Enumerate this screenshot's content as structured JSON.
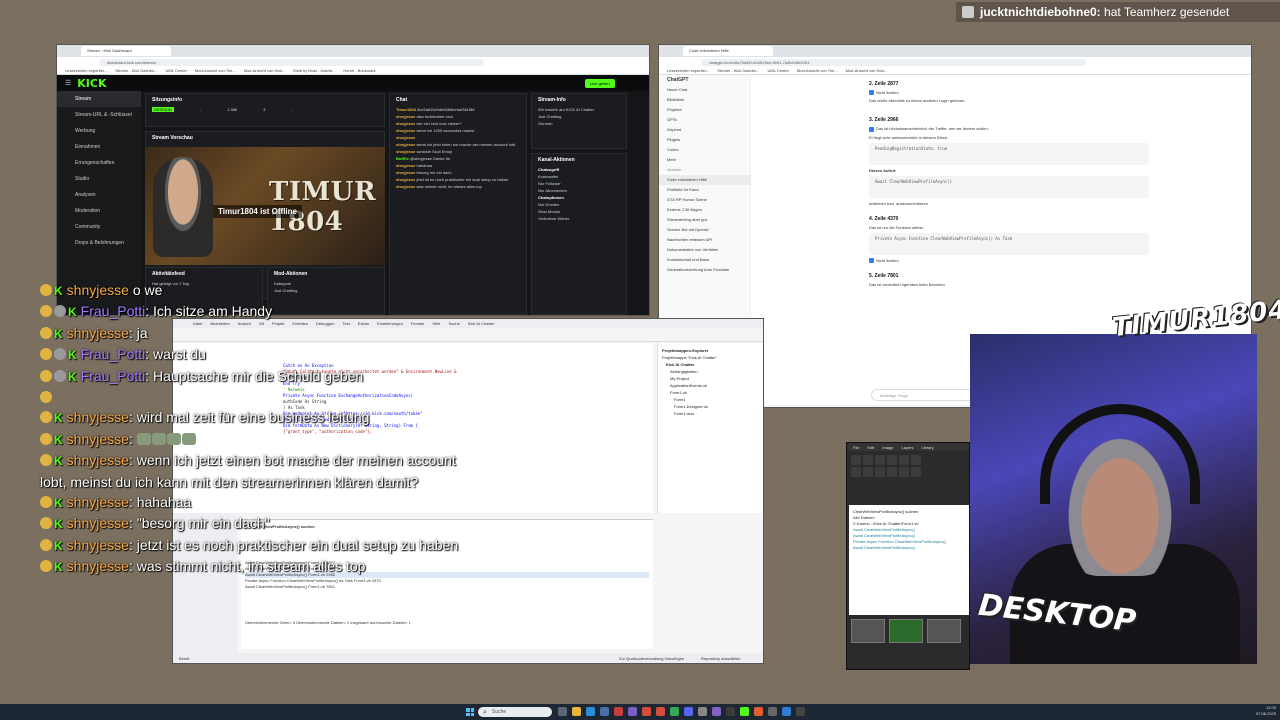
{
  "notification": {
    "user": "jucktnichtdiebohne0:",
    "text": " hat Teamherz gesendet"
  },
  "kick_window": {
    "tab_title": "Stream - Kick Dashboard",
    "url": "dashboard.kick.com/stream",
    "bookmarks": [
      "Lesezeichen importier...",
      "Stream - Kick Dashbo...",
      "UML Center",
      "Mod-Ansicht von Tim...",
      "Mod-Ansicht von Kick...",
      "Multi by Mobi - Dashb...",
      "Home - Bookmark"
    ],
    "logo": "KICK",
    "live_button": "Live gehen",
    "sidebar": [
      {
        "label": "Stream"
      },
      {
        "label": "Stream-URL & -Schlüssel"
      },
      {
        "label": "Werbung"
      },
      {
        "label": "Einnahmen"
      },
      {
        "label": "Errungenschaften"
      },
      {
        "label": "Studio"
      },
      {
        "label": "Analysen"
      },
      {
        "label": "Moderation"
      },
      {
        "label": "Community"
      },
      {
        "label": "Drops & Belohnungen"
      }
    ],
    "session_title": "Sitzungsinfo",
    "session_values": [
      "SESSION",
      "-",
      "1.386",
      "3",
      "-"
    ],
    "stream_preview_title": "Stream Vorschau",
    "banner_title": "TIMUR 1804",
    "offline_text": "Timur1804 ist Offline",
    "activity_title": "Aktivitätsfeed",
    "activity_row": "Hat gefolgt vor 1 Tag",
    "mod_title": "Mod-Aktionen",
    "mod_row_label": "Kategorie",
    "mod_row_value": "Just Chatting",
    "chat_title": "Chat",
    "chat_rows": [
      {
        "user": "Timur1804",
        "text": "5ce5a815c0db458dbefad381f86"
      },
      {
        "user": "shnyjesse",
        "text": "also funktioniert nice"
      },
      {
        "user": "shnyjesse",
        "text": "wie viel sind max viewer?"
      },
      {
        "user": "shnyjesse",
        "text": "wenn ich 1000 accountss mache"
      },
      {
        "user": "shnyjesse",
        "text": ""
      },
      {
        "user": "shnyjesse",
        "text": "wenn ich jetzt einen bot mache der meinen account lobt"
      },
      {
        "user": "shnyjesse",
        "text": "schickte Skull Emoji"
      },
      {
        "user": "BotRix",
        "text": "@shnyjesse Danke für"
      },
      {
        "user": "shnyjesse",
        "text": "hahahaa"
      },
      {
        "user": "shnyjesse",
        "text": "besorg mir ein dach"
      },
      {
        "user": "shnyjesse",
        "text": "jetzt ist es noch praktischer ein dual setup zu haben"
      },
      {
        "user": "shnyjesse",
        "text": "was stimmt nicht, im stream alles top"
      }
    ],
    "info_title": "Stream-Info",
    "info_text": "Wir basteln am KICK AI Chatter",
    "info_category": "Just Chatting",
    "info_language": "German",
    "channel_actions_title": "Kanal-Aktionen",
    "chat_access_title": "Chatzugriff",
    "chat_access_rows": [
      "Kontosalter",
      "Nur Follower",
      "Nur Abonnenten"
    ],
    "chat_options_title": "Chatoptionen",
    "chat_options_rows": [
      "Nur Emotes",
      "Slow-Modus",
      "Verbotene Wörter"
    ]
  },
  "gpt_window": {
    "tab_title": "Code extrahieren Hilfe",
    "url": "chatgpt.com/c/6a73d4f0-e0d5-f3ee-9b91-7a4be16b2291",
    "brand": "ChatGPT",
    "sidebar": [
      "Neuer Chat",
      "Bibliothek",
      "Projekte",
      "GPTs",
      "Gepinnt",
      "Plugins",
      "Codex",
      "Mehr",
      "Aktuelle",
      "Code extrahieren Hilfe",
      "Profilbild für Kand",
      "GTA RP Humor Szene",
      "Externe C30 Bogen",
      "Streamerbing aber gut",
      "Service Bot mit OpenAI",
      "Nachrichten erfassen API",
      "Dokumentation von Verfüllen",
      "Kontaktschalt und Bann",
      "Generationsrichtung Auto Produkte"
    ],
    "sections": [
      {
        "heading": "2. Zeile 2877",
        "text": "Nicht ändern",
        "note": "Das dürfte ebenfalls zu einem anderen Login gehören."
      },
      {
        "heading": "3. Zeile 2966",
        "text": "Das ist höchstwahrscheinlich der Treffer, den wir ändern wollen.",
        "note": "Er liegt sehr wahrscheinlich in diesem Block:"
      },
      {
        "heading": "",
        "text": "Diesen Aufruf:",
        "note": "entfernen bzw. auskommentieren."
      },
      {
        "heading": "4. Zeile 4370",
        "text": "Das ist nur die Funktion selbst:",
        "note": "Nicht ändern"
      },
      {
        "heading": "5. Zeile 7801",
        "text": "Das ist vermutlich irgendwo beim Beenden",
        "note": ""
      }
    ],
    "code_blocks": [
      "PendingRegistrationState: true",
      "Await ClearWebViewProfileAsync()",
      "Private Async Function ClearWebViewProfileAsync() As Task"
    ],
    "input_placeholder": "Beliebige Frage"
  },
  "vs_window": {
    "menu": [
      "Datei",
      "Bearbeiten",
      "Ansicht",
      "Git",
      "Projekt",
      "Erstellen",
      "Debuggen",
      "Test",
      "Extras",
      "Erweiterungen",
      "Fenster",
      "Hilfe",
      "Suche",
      "Kick AI Chatter"
    ],
    "editor_lines": [
      {
        "cls": "kw",
        "t": "Catch ex As Exception"
      },
      {
        "cls": "str",
        "t": "\"OAuth Callback konnte nicht verarbeitet werden\" & Environment.NewLine &"
      },
      {
        "cls": "",
        "t": "ex.Message"
      },
      {
        "cls": "kw",
        "t": "End Try"
      },
      {
        "cls": "cm",
        "t": "' Verweis"
      },
      {
        "cls": "kw",
        "t": "Private Async Function ExchangeAuthorizationCodeAsync("
      },
      {
        "cls": "",
        "t": "authCode As String"
      },
      {
        "cls": "",
        "t": ") As Task"
      },
      {
        "cls": "kw",
        "t": "Dim endpoint As String = \"https://id.kick.com/oauth/token\""
      },
      {
        "cls": "kw",
        "t": "Using client As New HttpClient()"
      },
      {
        "cls": "kw",
        "t": "Dim formData As New Dictionary(Of String, String) From {"
      },
      {
        "cls": "str",
        "t": "{\"grant_type\", \"authorization_code\"},"
      }
    ],
    "solution_title": "Projektmappen-Explorer",
    "solution_items": [
      "Projektmappe \"Kick AI Chatter\"",
      "Kick AI Chatter",
      "Abhängigkeiten",
      "My Project",
      "ApplicationEvents.vb",
      "Form1.vb",
      "Form1",
      "Form1.Designer.vb",
      "Form1.resx"
    ],
    "find_title": "ClearWebViewProfileAsync() suchen",
    "find_rows": [
      "Await ClearWebViewProfileAsync()  Form1.vb  2877",
      "Await ClearWebViewProfileAsync()  Form1.vb  2896",
      "Await ClearWebViewProfileAsync()  Form1.vb  2966",
      "Private Async Function ClearWebViewProfileAsync() As Task  Form1.vb  4370",
      "Await ClearWebViewProfileAsync()  Form1.vb  7801"
    ],
    "find_summary": "Übereinstimmende Zeilen: 5  Übereinstimmende Dateien: 1  Insgesamt durchsuchte Dateien: 1",
    "status": "Bereit",
    "status_right": "Zur Quellcodeverwaltung hinzufügen",
    "status_repo": "Repository auswählen"
  },
  "paint_window": {
    "menu": [
      "File",
      "Edit",
      "Image",
      "Layers",
      "Library"
    ],
    "canvas_rows": [
      "ClearWebViewProfileAsync() suchen",
      "Alle Dateien",
      "C:\\Users\\...\\Kick AI Chatter\\Form1.vb",
      "Await ClearWebViewProfileAsync()",
      "Await ClearWebViewProfileAsync()",
      "Private Async Function ClearWebViewProfileAsync()",
      "Await ClearWebViewProfileAsync()"
    ]
  },
  "webcam": {
    "brand_top": "TIMUR1804",
    "brand_bottom": "DESKTOP"
  },
  "chat_overlay": [
    {
      "user": "shnyjesse",
      "badges": [
        "gold"
      ],
      "text": "o we"
    },
    {
      "user": "Frau_Potti",
      "badges": [
        "gold",
        "grey"
      ],
      "text": "Ich sitze am Handy"
    },
    {
      "user": "shnyjesse",
      "badges": [
        "gold"
      ],
      "text": "ja"
    },
    {
      "user": "Frau_Potti",
      "badges": [
        "gold",
        "grey"
      ],
      "text": "warst du"
    },
    {
      "user": "Frau_Potti",
      "badges": [
        "gold",
        "grey"
      ],
      "text": "Hauptsache mir die Schuld geben"
    },
    {
      "user": "",
      "badges": [
        "gold"
      ],
      "text": ""
    },
    {
      "user": "shnyjesse",
      "badges": [
        "gold"
      ],
      "text": "wird mal zeit für eine business leitung"
    },
    {
      "user": "shnyjesse",
      "badges": [
        "gold"
      ],
      "text": ""
    },
    {
      "user": "shnyjesse",
      "badges": [
        "gold"
      ],
      "text": "wenn ich jetzt einen bot mache der meinen account lobt, meinst du ich kann mit den streamerinnen klären damit?"
    },
    {
      "user": "shnyjesse",
      "badges": [
        "gold"
      ],
      "text": "hahahaa"
    },
    {
      "user": "shnyjesse",
      "badges": [
        "gold"
      ],
      "text": "\"besorg mir ein dach\""
    },
    {
      "user": "shnyjesse",
      "badges": [
        "gold"
      ],
      "text": "jetzt ist es noch praktischer ein dual setup zu haben"
    },
    {
      "user": "shnyjesse",
      "badges": [
        "gold"
      ],
      "text": "was stimmt nicht, im stream alles top"
    }
  ],
  "taskbar": {
    "search": "Suche",
    "time": "12:00",
    "date": "07.08.2025"
  }
}
